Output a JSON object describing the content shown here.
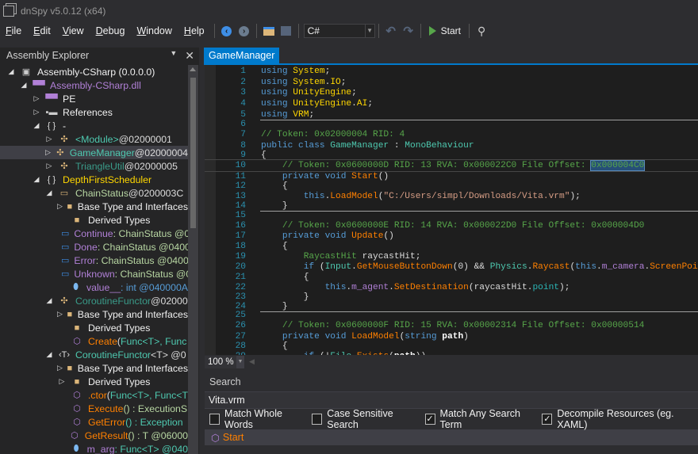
{
  "window": {
    "title": "dnSpy v5.0.12 (x64)"
  },
  "menu": [
    {
      "key": "F",
      "rest": "ile"
    },
    {
      "key": "E",
      "rest": "dit"
    },
    {
      "key": "V",
      "rest": "iew"
    },
    {
      "key": "D",
      "rest": "ebug"
    },
    {
      "key": "W",
      "rest": "indow"
    },
    {
      "key": "H",
      "rest": "elp"
    }
  ],
  "toolbar": {
    "language": "C#",
    "start_label": "Start",
    "back_icon": "arrow-left-circle",
    "forward_icon": "arrow-right-circle",
    "search_icon": "magnifier"
  },
  "explorer": {
    "title": "Assembly Explorer",
    "items": [
      {
        "d": 0,
        "exp": "open",
        "icon": "assembly",
        "parts": [
          [
            "Assembly-CSharp (0.0.0.0)",
            "#f1f1f1"
          ]
        ]
      },
      {
        "d": 1,
        "exp": "open",
        "icon": "module",
        "parts": [
          [
            "Assembly-CSharp.dll",
            "#b180d7"
          ]
        ]
      },
      {
        "d": 2,
        "exp": "closed",
        "icon": "module",
        "parts": [
          [
            "PE",
            "#f1f1f1"
          ]
        ]
      },
      {
        "d": 2,
        "exp": "closed",
        "icon": "references",
        "parts": [
          [
            "References",
            "#f1f1f1"
          ]
        ]
      },
      {
        "d": 2,
        "exp": "open",
        "icon": "namespace",
        "parts": [
          [
            "-",
            "#f1f1f1"
          ]
        ]
      },
      {
        "d": 3,
        "exp": "closed",
        "icon": "class",
        "parts": [
          [
            "<Module>",
            "#4ec9b0"
          ],
          [
            " @02000001",
            "#dcdcdc"
          ]
        ]
      },
      {
        "d": 3,
        "exp": "closed",
        "icon": "class",
        "sel": true,
        "parts": [
          [
            "GameManager",
            "#4ec9b0"
          ],
          [
            " @02000004",
            "#dcdcdc"
          ]
        ]
      },
      {
        "d": 3,
        "exp": "closed",
        "icon": "class",
        "parts": [
          [
            "TriangleUtil",
            "#3a9c8a"
          ],
          [
            " @02000005",
            "#dcdcdc"
          ]
        ]
      },
      {
        "d": 2,
        "exp": "open",
        "icon": "namespace",
        "parts": [
          [
            "DepthFirstScheduler",
            "#ffd700"
          ]
        ]
      },
      {
        "d": 3,
        "exp": "open",
        "icon": "enum",
        "parts": [
          [
            "ChainStatus",
            "#b8d7a3"
          ],
          [
            " @0200003C",
            "#dcdcdc"
          ]
        ]
      },
      {
        "d": 4,
        "exp": "closed",
        "icon": "folder",
        "parts": [
          [
            "Base Type and Interfaces",
            "#f1f1f1"
          ]
        ]
      },
      {
        "d": 4,
        "exp": "none",
        "icon": "folder",
        "parts": [
          [
            "Derived Types",
            "#f1f1f1"
          ]
        ]
      },
      {
        "d": 4,
        "exp": "none",
        "icon": "enum-value",
        "parts": [
          [
            "Continue",
            "#b180d7"
          ],
          [
            " : ChainStatus @04000",
            "#b8d7a3"
          ]
        ]
      },
      {
        "d": 4,
        "exp": "none",
        "icon": "enum-value",
        "parts": [
          [
            "Done",
            "#b180d7"
          ],
          [
            " : ChainStatus @04000",
            "#b8d7a3"
          ]
        ]
      },
      {
        "d": 4,
        "exp": "none",
        "icon": "enum-value",
        "parts": [
          [
            "Error",
            "#b180d7"
          ],
          [
            " : ChainStatus @04000",
            "#b8d7a3"
          ]
        ]
      },
      {
        "d": 4,
        "exp": "none",
        "icon": "enum-value",
        "parts": [
          [
            "Unknown",
            "#b180d7"
          ],
          [
            " : ChainStatus @0400",
            "#b8d7a3"
          ]
        ]
      },
      {
        "d": 4,
        "exp": "none",
        "icon": "field",
        "parts": [
          [
            "value__",
            "#b180d7"
          ],
          [
            " : int @040000A",
            "#569cd6"
          ]
        ]
      },
      {
        "d": 3,
        "exp": "open",
        "icon": "class",
        "parts": [
          [
            "CoroutineFunctor",
            "#3a9c8a"
          ],
          [
            " @02000",
            "#dcdcdc"
          ]
        ]
      },
      {
        "d": 4,
        "exp": "closed",
        "icon": "folder",
        "parts": [
          [
            "Base Type and Interfaces",
            "#f1f1f1"
          ]
        ]
      },
      {
        "d": 4,
        "exp": "none",
        "icon": "folder",
        "parts": [
          [
            "Derived Types",
            "#f1f1f1"
          ]
        ]
      },
      {
        "d": 4,
        "exp": "none",
        "icon": "method",
        "parts": [
          [
            "Create",
            "#ff8000"
          ],
          [
            "(",
            "#dcdcdc"
          ],
          [
            "Func",
            "#4ec9b0"
          ],
          [
            "<T>, Func",
            "#4ec9b0"
          ]
        ]
      },
      {
        "d": 3,
        "exp": "open",
        "icon": "generic-class",
        "parts": [
          [
            "CoroutineFunctor",
            "#4ec9b0"
          ],
          [
            "<T> @0",
            "#dcdcdc"
          ]
        ]
      },
      {
        "d": 4,
        "exp": "closed",
        "icon": "folder",
        "parts": [
          [
            "Base Type and Interfaces",
            "#f1f1f1"
          ]
        ]
      },
      {
        "d": 4,
        "exp": "closed",
        "icon": "folder",
        "parts": [
          [
            "Derived Types",
            "#f1f1f1"
          ]
        ]
      },
      {
        "d": 4,
        "exp": "none",
        "icon": "method",
        "parts": [
          [
            ".ctor",
            "#ff8000"
          ],
          [
            "(",
            "#dcdcdc"
          ],
          [
            "Func",
            "#4ec9b0"
          ],
          [
            "<T>, Func<T",
            "#4ec9b0"
          ]
        ]
      },
      {
        "d": 4,
        "exp": "none",
        "icon": "method",
        "parts": [
          [
            "Execute",
            "#ff8000"
          ],
          [
            "() : ExecutionS",
            "#b8d7a3"
          ]
        ]
      },
      {
        "d": 4,
        "exp": "none",
        "icon": "method",
        "parts": [
          [
            "GetError",
            "#ff8000"
          ],
          [
            "() : Exception",
            "#4ec9b0"
          ]
        ]
      },
      {
        "d": 4,
        "exp": "none",
        "icon": "method",
        "parts": [
          [
            "GetResult",
            "#ff8000"
          ],
          [
            "() : T @06000",
            "#b8d7a3"
          ]
        ]
      },
      {
        "d": 4,
        "exp": "none",
        "icon": "field-private",
        "parts": [
          [
            "m_arg",
            "#b180d7"
          ],
          [
            " : Func<T> @040",
            "#4ec9b0"
          ]
        ]
      }
    ]
  },
  "tab": {
    "label": "GameManager"
  },
  "code": [
    {
      "n": "1",
      "s": [
        [
          "using ",
          "kw"
        ],
        [
          "System",
          "ns"
        ],
        [
          ";",
          "pl"
        ]
      ]
    },
    {
      "n": "2",
      "s": [
        [
          "using ",
          "kw"
        ],
        [
          "System",
          "ns"
        ],
        [
          ".",
          "pl"
        ],
        [
          "IO",
          "ns"
        ],
        [
          ";",
          "pl"
        ]
      ]
    },
    {
      "n": "3",
      "s": [
        [
          "using ",
          "kw"
        ],
        [
          "UnityEngine",
          "ns"
        ],
        [
          ";",
          "pl"
        ]
      ]
    },
    {
      "n": "4",
      "s": [
        [
          "using ",
          "kw"
        ],
        [
          "UnityEngine",
          "ns"
        ],
        [
          ".",
          "pl"
        ],
        [
          "AI",
          "ns"
        ],
        [
          ";",
          "pl"
        ]
      ]
    },
    {
      "n": "5",
      "sep": true,
      "s": [
        [
          "using ",
          "kw"
        ],
        [
          "VRM",
          "ns"
        ],
        [
          ";",
          "pl"
        ]
      ]
    },
    {
      "n": "6",
      "s": []
    },
    {
      "n": "7",
      "s": [
        [
          "// Token: 0x02000004 RID: 4",
          "cm"
        ]
      ]
    },
    {
      "n": "8",
      "s": [
        [
          "public class ",
          "kw"
        ],
        [
          "GameManager",
          "ty"
        ],
        [
          " : ",
          "pl"
        ],
        [
          "MonoBehaviour",
          "ty"
        ]
      ]
    },
    {
      "n": "9",
      "s": [
        [
          "{",
          "pl"
        ]
      ]
    },
    {
      "n": "10",
      "cur": true,
      "s": [
        [
          "    // Token: 0x0600000D RID: 13 RVA: 0x000022C0 File Offset: ",
          "cm"
        ],
        [
          "0x000004C0",
          "cm hl"
        ]
      ]
    },
    {
      "n": "11",
      "s": [
        [
          "    private void ",
          "kw"
        ],
        [
          "Start",
          "me"
        ],
        [
          "()",
          "pl"
        ]
      ]
    },
    {
      "n": "12",
      "s": [
        [
          "    {",
          "pl"
        ]
      ]
    },
    {
      "n": "13",
      "s": [
        [
          "        this",
          "kw"
        ],
        [
          ".",
          "pl"
        ],
        [
          "LoadModel",
          "me"
        ],
        [
          "(",
          "pl"
        ],
        [
          "\"C:/Users/simpl/Downloads/Vita.vrm\"",
          "st"
        ],
        [
          ");",
          "pl"
        ]
      ]
    },
    {
      "n": "14",
      "sep": true,
      "s": [
        [
          "    }",
          "pl"
        ]
      ]
    },
    {
      "n": "15",
      "s": []
    },
    {
      "n": "16",
      "s": [
        [
          "    // Token: 0x0600000E RID: 14 RVA: 0x000022D0 File Offset: 0x000004D0",
          "cm"
        ]
      ]
    },
    {
      "n": "17",
      "s": [
        [
          "    private void ",
          "kw"
        ],
        [
          "Update",
          "me"
        ],
        [
          "()",
          "pl"
        ]
      ]
    },
    {
      "n": "18",
      "s": [
        [
          "    {",
          "pl"
        ]
      ]
    },
    {
      "n": "19",
      "s": [
        [
          "        ",
          "pl"
        ],
        [
          "RaycastHit",
          "cm"
        ],
        [
          " raycastHit;",
          "pl"
        ]
      ]
    },
    {
      "n": "20",
      "s": [
        [
          "        if ",
          "kw"
        ],
        [
          "(",
          "pl"
        ],
        [
          "Input",
          "ty"
        ],
        [
          ".",
          "pl"
        ],
        [
          "GetMouseButtonDown",
          "me"
        ],
        [
          "(0) && ",
          "pl"
        ],
        [
          "Physics",
          "ty"
        ],
        [
          ".",
          "pl"
        ],
        [
          "Raycast",
          "me"
        ],
        [
          "(",
          "pl"
        ],
        [
          "this",
          "kw"
        ],
        [
          ".",
          "pl"
        ],
        [
          "m_camera",
          "fi"
        ],
        [
          ".",
          "pl"
        ],
        [
          "ScreenPointToRay",
          "me"
        ]
      ]
    },
    {
      "n": "21",
      "s": [
        [
          "        {",
          "pl"
        ]
      ]
    },
    {
      "n": "22",
      "s": [
        [
          "            this",
          "kw"
        ],
        [
          ".",
          "pl"
        ],
        [
          "m_agent",
          "fi"
        ],
        [
          ".",
          "pl"
        ],
        [
          "SetDestination",
          "me"
        ],
        [
          "(raycastHit.",
          "pl"
        ],
        [
          "point",
          "pr"
        ],
        [
          ");",
          "pl"
        ]
      ]
    },
    {
      "n": "23",
      "s": [
        [
          "        }",
          "pl"
        ]
      ]
    },
    {
      "n": "24",
      "sep": true,
      "s": [
        [
          "    }",
          "pl"
        ]
      ]
    },
    {
      "n": "25",
      "s": []
    },
    {
      "n": "26",
      "s": [
        [
          "    // Token: 0x0600000F RID: 15 RVA: 0x00002314 File Offset: 0x00000514",
          "cm"
        ]
      ]
    },
    {
      "n": "27",
      "s": [
        [
          "    private void ",
          "kw"
        ],
        [
          "LoadModel",
          "me"
        ],
        [
          "(",
          "pl"
        ],
        [
          "string ",
          "kw"
        ],
        [
          "path",
          "pa"
        ],
        [
          ")",
          "pl"
        ]
      ]
    },
    {
      "n": "28",
      "s": [
        [
          "    {",
          "pl"
        ]
      ]
    },
    {
      "n": "29",
      "s": [
        [
          "        if ",
          "kw"
        ],
        [
          "(!",
          "pl"
        ],
        [
          "File",
          "ty"
        ],
        [
          ".",
          "pl"
        ],
        [
          "Exists",
          "me"
        ],
        [
          "(",
          "pl"
        ],
        [
          "path",
          "pa"
        ],
        [
          "))",
          "pl"
        ]
      ]
    }
  ],
  "zoom": {
    "value": "100 %"
  },
  "search": {
    "title": "Search",
    "query": "Vita.vrm",
    "options": [
      {
        "label": "Match Whole Words",
        "checked": false
      },
      {
        "label": "Case Sensitive Search",
        "checked": false
      },
      {
        "label": "Match Any Search Term",
        "checked": true
      },
      {
        "label": "Decompile Resources (eg. XAML)",
        "checked": true
      }
    ],
    "results": [
      {
        "label": "Start",
        "icon": "method-private"
      }
    ]
  }
}
